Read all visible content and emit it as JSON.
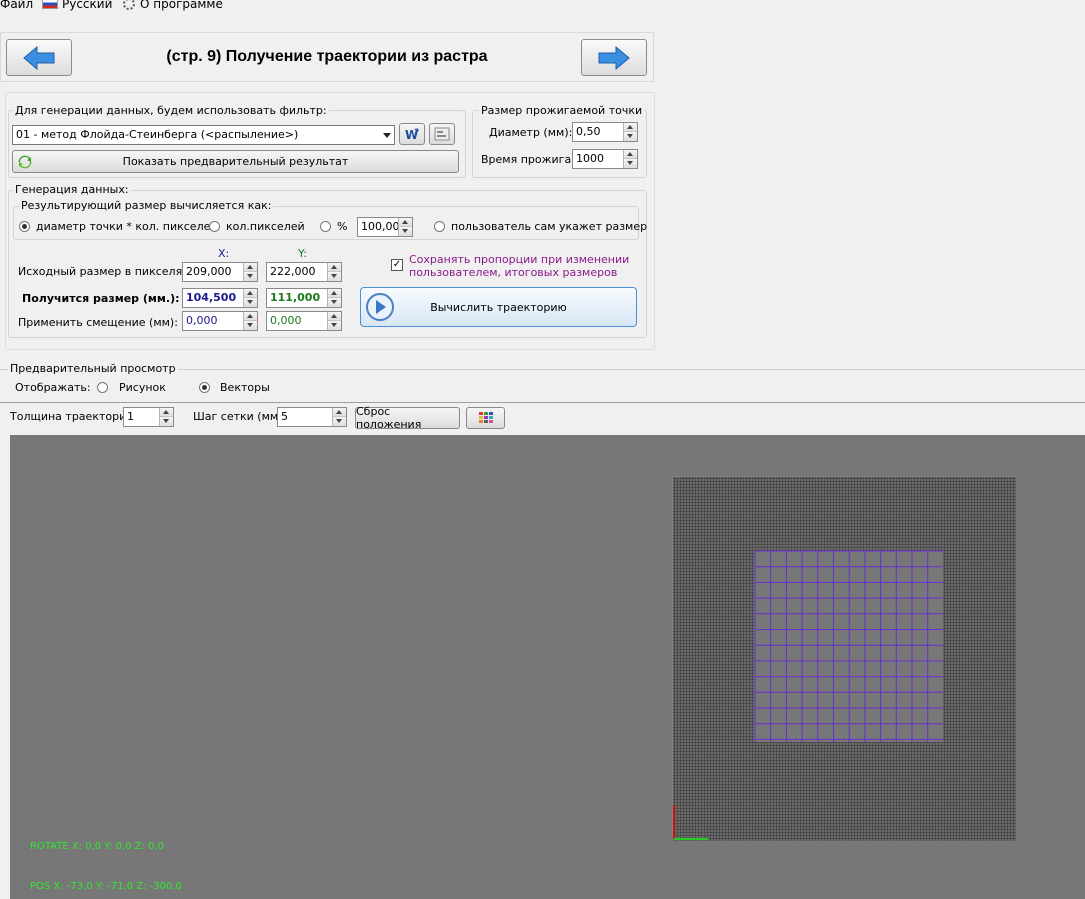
{
  "menu": {
    "file": "Файл",
    "language": "Русский",
    "about": "О программе"
  },
  "header": {
    "title": "(стр. 9) Получение траектории из растра"
  },
  "filter_group": {
    "label": "Для генерации данных, будем использовать фильтр:",
    "selected": "01 - метод Флойда-Стеинберга (<распыление>)",
    "preview_button": "Показать предварительный результат"
  },
  "point_group": {
    "label": "Размер прожигаемой точки",
    "diameter_label": "Диаметр (мм):",
    "diameter_value": "0,50",
    "burn_time_label": "Время прожига:",
    "burn_time_value": "1000"
  },
  "generation": {
    "label": "Генерация данных:",
    "calc_label": "Результирующий размер вычисляется как:",
    "options": [
      {
        "label": "диаметр точки * кол. пикселей",
        "selected": true
      },
      {
        "label": "кол.пикселей",
        "selected": false
      },
      {
        "label": "%",
        "selected": false
      },
      {
        "label": "пользователь сам укажет размер",
        "selected": false
      }
    ],
    "percent_value": "100,00",
    "x_header": "X:",
    "y_header": "Y:",
    "source_label": "Исходный размер в пикселях:",
    "source_x": "209,000",
    "source_y": "222,000",
    "result_label": "Получится размер (мм.):",
    "result_x": "104,500",
    "result_y": "111,000",
    "offset_label": "Применить смещение (мм):",
    "offset_x": "0,000",
    "offset_y": "0,000",
    "keep_proportions_line1": "Сохранять пропорции при изменении",
    "keep_proportions_line2": "пользователем, итоговых размеров",
    "keep_proportions_checked": true,
    "calc_button": "Вычислить траекторию"
  },
  "preview": {
    "label": "Предварительный просмотр",
    "display_label": "Отображать:",
    "display_options": [
      {
        "label": "Рисунок",
        "selected": false
      },
      {
        "label": "Векторы",
        "selected": true
      }
    ],
    "thickness_label": "Толщина траектории:",
    "thickness_value": "1",
    "grid_step_label": "Шаг сетки (мм.):",
    "grid_step_value": "5",
    "reset_button": "Сброс положения",
    "rotate_text": "ROTATE X: 0,0  Y: 0,0 Z: 0,0",
    "pos_text": "POS X: -73,0  Y: -71,0 Z: -300,0"
  },
  "colors": {
    "viewport_bg": "#777777",
    "grid": "#6a2fd0",
    "overlay_text": "#2ee82e",
    "result_x": "#1a1a8c",
    "result_y": "#1a7a1a",
    "keep_text": "#8a1a8a",
    "axis_x": "#22cc22",
    "axis_y": "#cc1111"
  }
}
